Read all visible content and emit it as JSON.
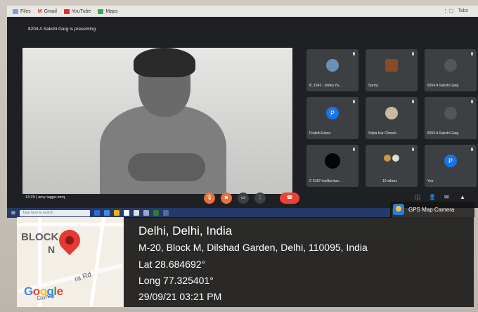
{
  "browser": {
    "bookmarks": [
      "Files",
      "Gmail",
      "YouTube",
      "Maps"
    ],
    "right_text": "Tabs"
  },
  "meet": {
    "presenting_text": "8204 A Sakshi Garg is presenting",
    "meeting_info": "13:20 | amy-iaggs-nmq",
    "tiles": [
      {
        "name": "B, 1543 - Ishika Ya..."
      },
      {
        "name": "Sunny"
      },
      {
        "name": "8204 A Sakshi Garg"
      },
      {
        "name": "Prakriti Raina",
        "letter": "P"
      },
      {
        "name": "Srijita Kar Chowd..."
      },
      {
        "name": "8204 A Sakshi Garg"
      },
      {
        "name": "C 6187 mulika ban..."
      },
      {
        "name": "10 others"
      },
      {
        "name": "You",
        "letter": "P"
      }
    ]
  },
  "taskbar": {
    "search_placeholder": "Type here to search"
  },
  "gps": {
    "app_name": "GPS Map Camera",
    "city": "Delhi, Delhi, India",
    "address": "M-20, Block M, Dilshad Garden, Delhi, 110095, India",
    "lat": "Lat 28.684692°",
    "long": "Long 77.325401°",
    "datetime": "29/09/21 03:21 PM",
    "map": {
      "label_block": "BLOCK",
      "label_n": "N",
      "label_road": "ra Rd",
      "label_gurugr": "Gurug",
      "google": "Google"
    }
  },
  "colors": {
    "meet_bg": "#1f2023",
    "tile_bg": "#3c4043",
    "hangup": "#ea4335",
    "control_orange": "#e8703a",
    "taskbar": "#253a66",
    "pin": "#e53935"
  }
}
